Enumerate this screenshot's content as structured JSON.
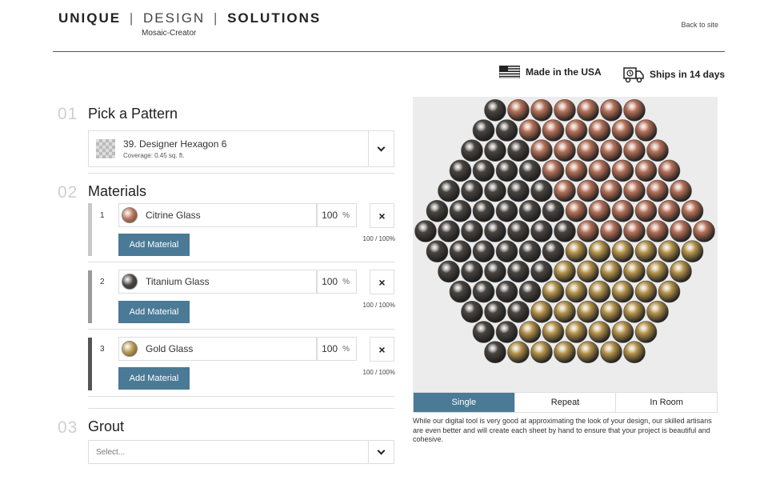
{
  "brand": {
    "part1": "UNIQUE",
    "part2": "DESIGN",
    "part3": "SOLUTIONS",
    "separator": "|",
    "subtitle": "Mosaic-Creator"
  },
  "header": {
    "back_link": "Back to site",
    "badge_usa": "Made in the USA",
    "badge_ship": "Ships in 14 days"
  },
  "steps": {
    "pattern": {
      "number": "01",
      "title": "Pick a Pattern"
    },
    "materials": {
      "number": "02",
      "title": "Materials"
    },
    "grout": {
      "number": "03",
      "title": "Grout"
    }
  },
  "pattern": {
    "name": "39. Designer Hexagon 6",
    "coverage": "Coverage: 0.45 sq. ft."
  },
  "materials": [
    {
      "index": "1",
      "name": "Citrine Glass",
      "percent": "100",
      "percent_sign": "%",
      "remove": "×",
      "add_label": "Add Material",
      "total": "100 / 100%",
      "color": "#b8735a",
      "bar_color": "#c8c8c8"
    },
    {
      "index": "2",
      "name": "Titanium Glass",
      "percent": "100",
      "percent_sign": "%",
      "remove": "×",
      "add_label": "Add Material",
      "total": "100 / 100%",
      "color": "#4a4540",
      "bar_color": "#9a9a9a"
    },
    {
      "index": "3",
      "name": "Gold Glass",
      "percent": "100",
      "percent_sign": "%",
      "remove": "×",
      "add_label": "Add Material",
      "total": "100 / 100%",
      "color": "#b8964e",
      "bar_color": "#555555"
    }
  ],
  "grout": {
    "placeholder": "Select..."
  },
  "preview": {
    "tabs": [
      "Single",
      "Repeat",
      "In Room"
    ],
    "active_tab": "Single",
    "disclaimer": "While our digital tool is very good at approximating the look of your design, our skilled artisans are even better and will create each sheet by hand to ensure that your project is beautiful and cohesive.",
    "colors": {
      "citrine": "#b8735a",
      "titanium": "#4a4540",
      "gold": "#b8964e",
      "background": "#ececec"
    }
  },
  "colors": {
    "accent": "#4a7a96"
  }
}
